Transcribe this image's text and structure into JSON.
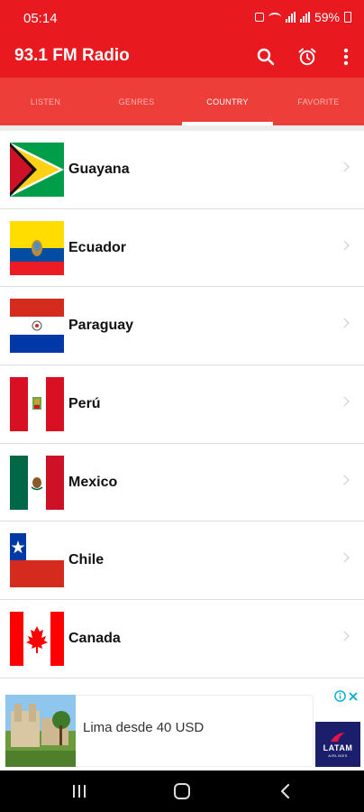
{
  "status_bar": {
    "time": "05:14",
    "battery": "59%"
  },
  "app_bar": {
    "title": "93.1 FM Radio"
  },
  "tabs": [
    {
      "label": "LISTEN",
      "active": false
    },
    {
      "label": "GENRES",
      "active": false
    },
    {
      "label": "COUNTRY",
      "active": true
    },
    {
      "label": "FAVORITE",
      "active": false
    }
  ],
  "countries": [
    {
      "name": "Guayana"
    },
    {
      "name": "Ecuador"
    },
    {
      "name": "Paraguay"
    },
    {
      "name": "Perú"
    },
    {
      "name": "Mexico"
    },
    {
      "name": "Chile"
    },
    {
      "name": "Canada"
    }
  ],
  "ad": {
    "text": "Lima desde 40 USD",
    "logo_text": "LATAM",
    "logo_subtext": "AIRLINES"
  },
  "colors": {
    "primary": "#e8191f",
    "tab_bar": "#ee3e3a",
    "accent_ad": "#1b1f6b"
  },
  "icons": {
    "app_bar": [
      "search-icon",
      "alarm-icon",
      "more-vert-icon"
    ],
    "nav": [
      "recent-apps-icon",
      "home-icon",
      "back-icon"
    ]
  }
}
